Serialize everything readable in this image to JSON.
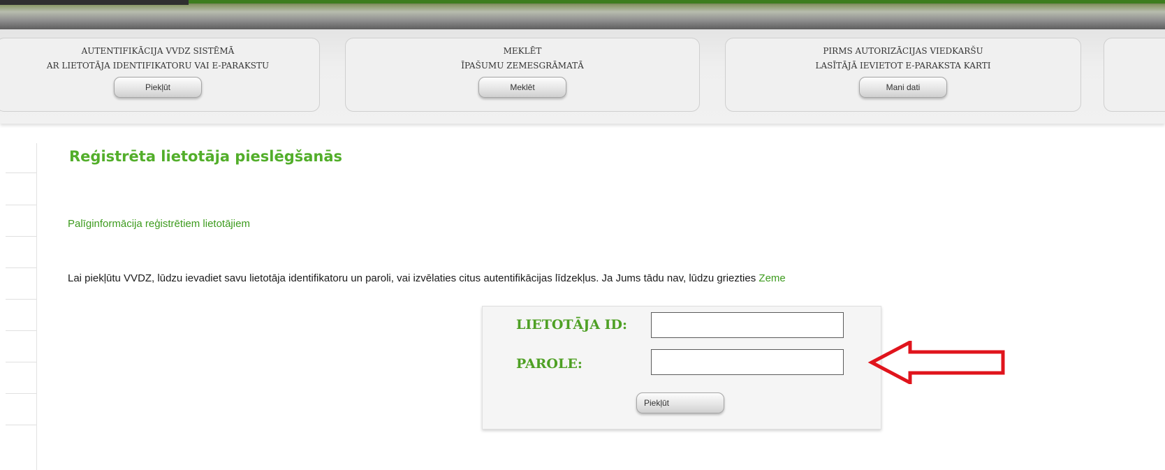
{
  "colors": {
    "accent_green": "#52ae2a",
    "link_green": "#3d9b1e",
    "annotation_red": "#e0141c"
  },
  "action_bar": {
    "panels": [
      {
        "line1": "AUTENTIFIKĀCIJA VVDZ SISTĒMĀ",
        "line2": "AR LIETOTĀJA IDENTIFIKATORU VAI E-PARAKSTU",
        "button": "Piekļūt"
      },
      {
        "line1": "MEKLĒT",
        "line2": "ĪPAŠUMU ZEMESGRĀMATĀ",
        "button": "Meklēt"
      },
      {
        "line1": "PIRMS AUTORIZĀCIJAS VIEDKARŠU",
        "line2": "LASĪTĀJĀ IEVIETOT E-PARAKSTA KARTI",
        "button": "Mani dati"
      }
    ]
  },
  "main": {
    "title": "Reģistrēta lietotāja pieslēgšanās",
    "help_link": "Palīginformācija reģistrētiem lietotājiem",
    "intro_text": "Lai piekļūtu VVDZ, lūdzu ievadiet savu lietotāja identifikatoru un paroli, vai izvēlaties citus autentifikācijas līdzekļus. Ja Jums tādu nav, lūdzu griezties ",
    "intro_link": "Zeme"
  },
  "login_form": {
    "user_id_label": "LIETOTĀJA ID:",
    "user_id_value": "",
    "password_label": "PAROLE:",
    "password_value": "",
    "submit_label": "Piekļūt"
  },
  "annotation": {
    "icon": "red-arrow-left-icon"
  }
}
